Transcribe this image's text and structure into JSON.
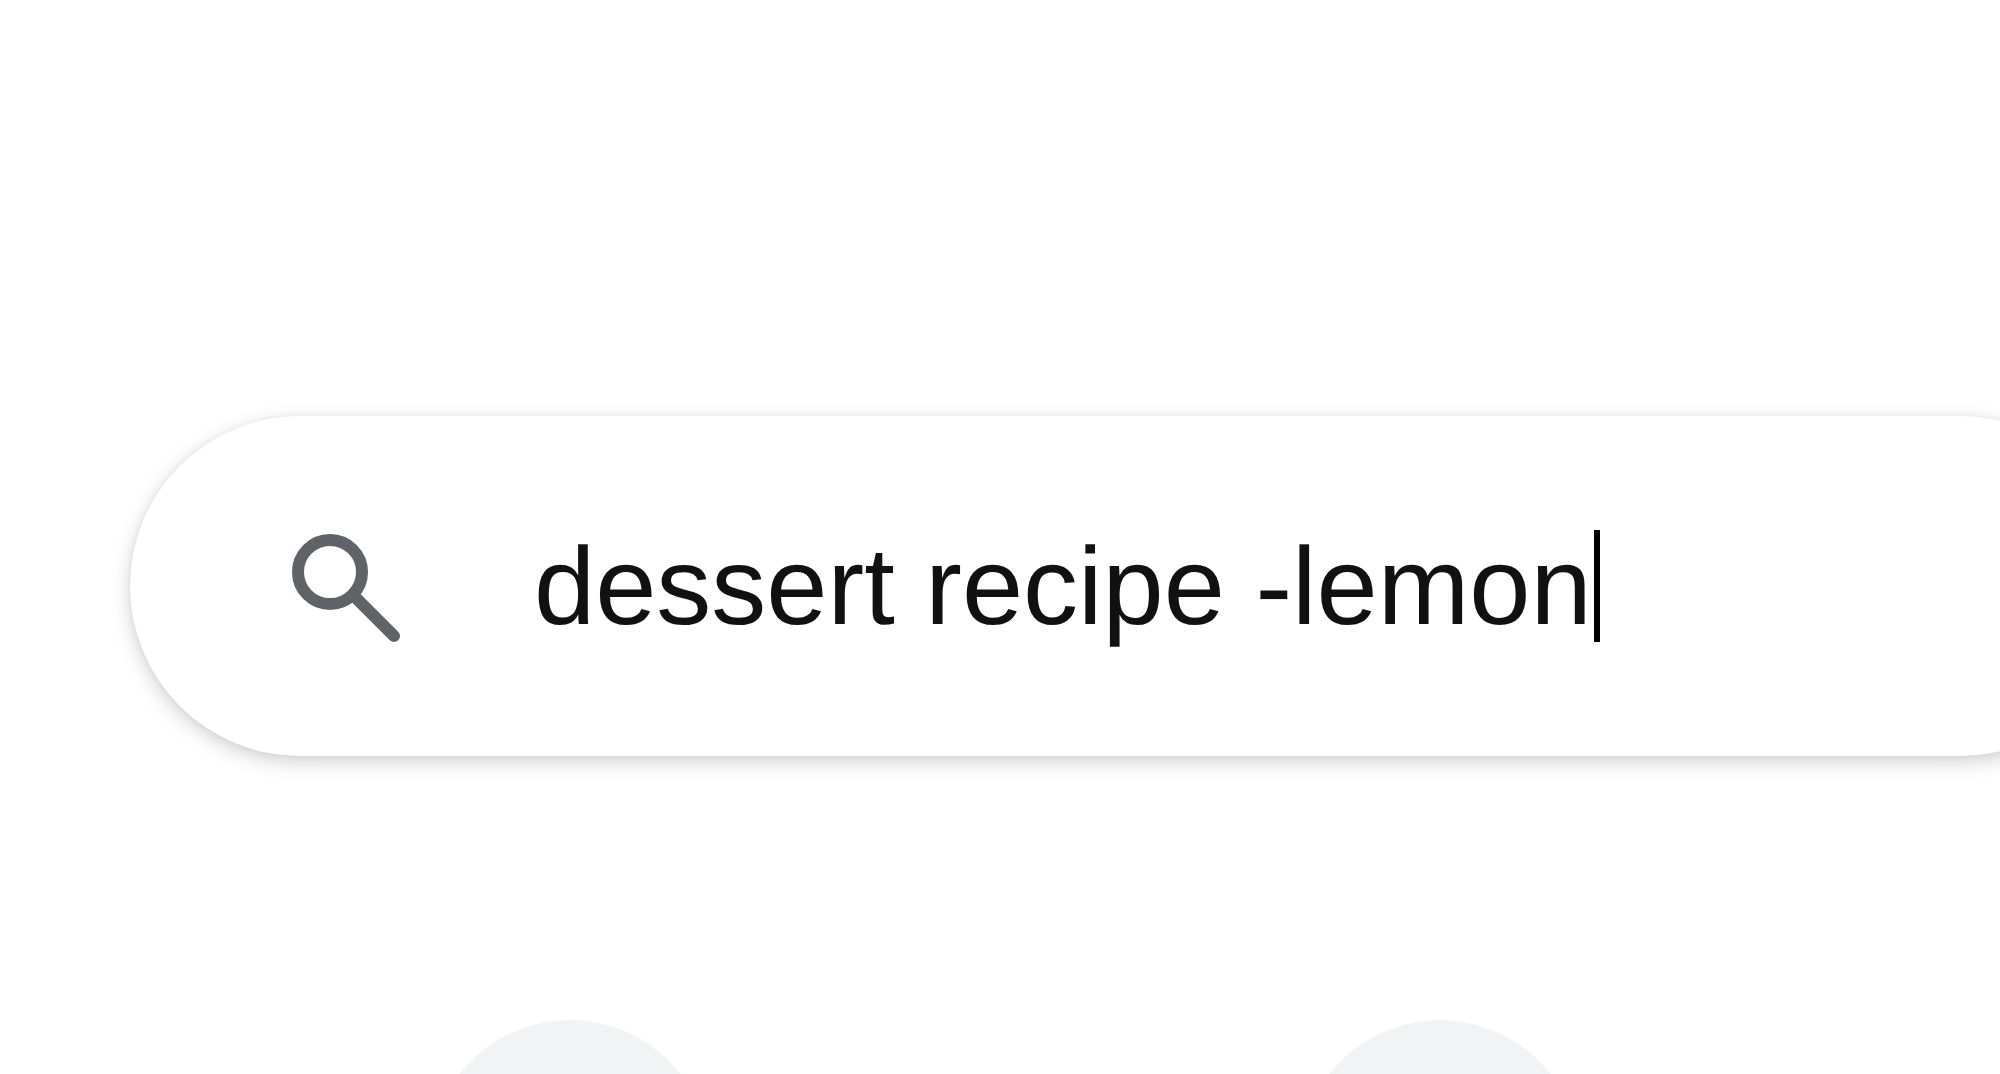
{
  "search": {
    "value": "dessert recipe -lemon"
  },
  "shortcuts": [
    {
      "kind": "circle"
    },
    {
      "kind": "circle"
    }
  ]
}
